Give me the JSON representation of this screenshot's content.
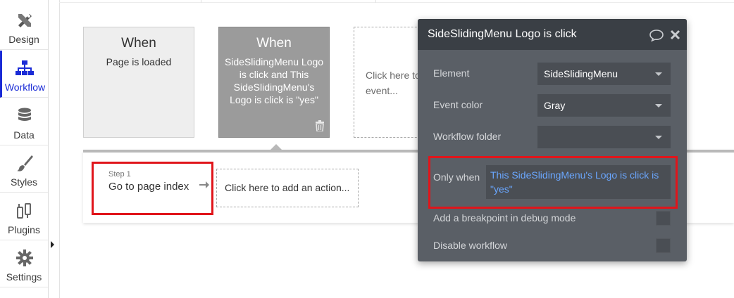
{
  "sidebar": {
    "items": [
      {
        "label": "Design",
        "icon": "design-icon"
      },
      {
        "label": "Workflow",
        "icon": "workflow-icon",
        "active": true
      },
      {
        "label": "Data",
        "icon": "database-icon"
      },
      {
        "label": "Styles",
        "icon": "brush-icon"
      },
      {
        "label": "Plugins",
        "icon": "plug-icon"
      },
      {
        "label": "Settings",
        "icon": "gear-icon"
      }
    ],
    "accent_color": "#1a2bd6"
  },
  "events": [
    {
      "when": "When",
      "description": "Page is loaded"
    },
    {
      "when": "When",
      "description": "SideSlidingMenu Logo is click and This SideSlidingMenu's Logo is click is \"yes\""
    }
  ],
  "add_event": {
    "text": "Click here to add an event..."
  },
  "action": {
    "step_number": "Step 1",
    "step_label": "Go to page index",
    "add_action_text": "Click here to add an action..."
  },
  "popup": {
    "title": "SideSlidingMenu Logo is click",
    "element_label": "Element",
    "element_value": "SideSlidingMenu",
    "event_color_label": "Event color",
    "event_color_value": "Gray",
    "workflow_folder_label": "Workflow folder",
    "workflow_folder_value": "",
    "only_when_label": "Only when",
    "only_when_value": "This SideSlidingMenu's Logo is click is \"yes\"",
    "breakpoint_label": "Add a breakpoint in debug mode",
    "disable_label": "Disable workflow",
    "highlight_color": "#e0151b"
  }
}
